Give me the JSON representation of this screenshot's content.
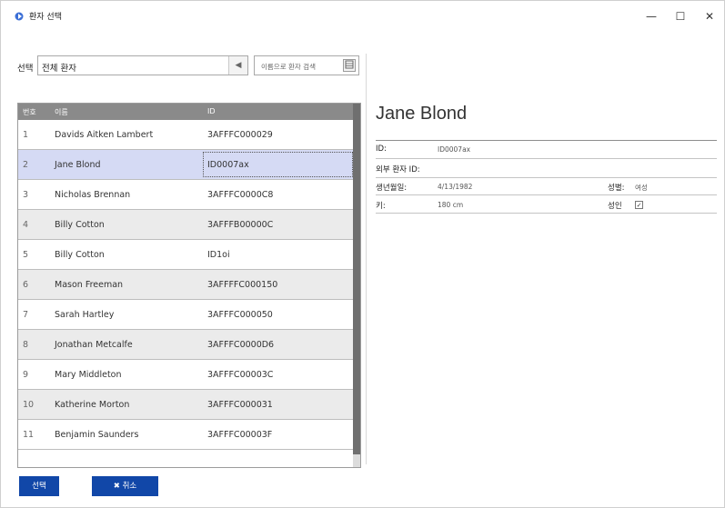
{
  "window": {
    "title": "환자 선택",
    "minimize": "—",
    "maximize": "☐",
    "close": "✕"
  },
  "filter": {
    "label": "선택",
    "value": "전체 환자",
    "arrow": "◀",
    "search_placeholder": "이름으로 환자 검색"
  },
  "grid": {
    "headers": {
      "num": "번호",
      "name": "이름",
      "id": "ID"
    },
    "rows": [
      {
        "num": "1",
        "name": "Davids Aitken Lambert",
        "id": "3AFFFC000029"
      },
      {
        "num": "2",
        "name": "Jane Blond",
        "id": "ID0007ax"
      },
      {
        "num": "3",
        "name": "Nicholas Brennan",
        "id": "3AFFFC0000C8"
      },
      {
        "num": "4",
        "name": "Billy Cotton",
        "id": "3AFFFB00000C"
      },
      {
        "num": "5",
        "name": "Billy Cotton",
        "id": "ID1oi"
      },
      {
        "num": "6",
        "name": "Mason Freeman",
        "id": "3AFFFFC000150"
      },
      {
        "num": "7",
        "name": "Sarah Hartley",
        "id": "3AFFFC000050"
      },
      {
        "num": "8",
        "name": "Jonathan Metcalfe",
        "id": "3AFFFC0000D6"
      },
      {
        "num": "9",
        "name": "Mary Middleton",
        "id": "3AFFFC00003C"
      },
      {
        "num": "10",
        "name": "Katherine Morton",
        "id": "3AFFFC000031"
      },
      {
        "num": "11",
        "name": "Benjamin Saunders",
        "id": "3AFFFC00003F"
      }
    ]
  },
  "buttons": {
    "select": "선택",
    "cancel": "✖ 취소"
  },
  "details": {
    "name": "Jane Blond",
    "id_label": "ID:",
    "id_value": "ID0007ax",
    "ext_id_label": "외부 환자 ID:",
    "dob_label": "생년월일:",
    "dob_value": "4/13/1982",
    "sex_label": "성별:",
    "sex_value": "여성",
    "height_label": "키:",
    "height_value": "180 cm",
    "adult_label": "성인",
    "adult_check": "✓"
  },
  "colors": {
    "accent": "#1147a8",
    "selected_row": "#d5daf4",
    "header": "#8a8a8a"
  }
}
